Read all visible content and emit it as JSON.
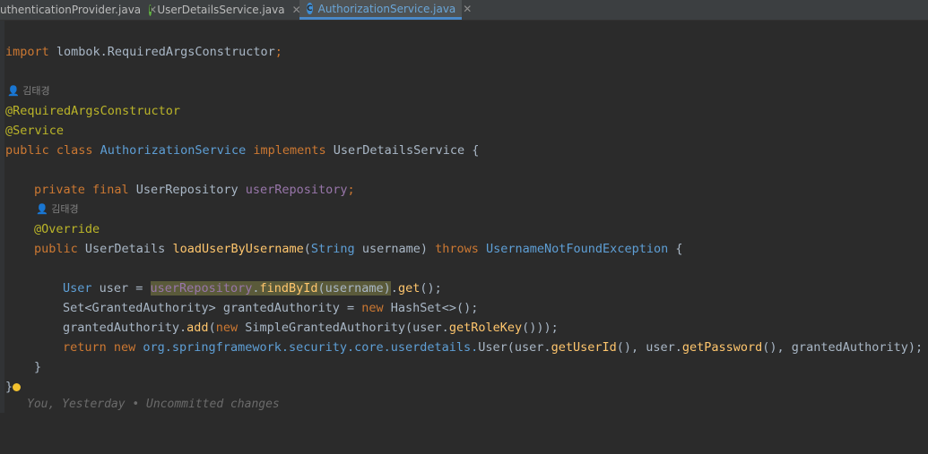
{
  "tabs": [
    {
      "label": "uthenticationProvider.java"
    },
    {
      "label": "UserDetailsService.java"
    },
    {
      "label": "AuthorizationService.java"
    }
  ],
  "author": "김태경",
  "code": {
    "l1": {
      "a": "import ",
      "b": "lombok.RequiredArgsConstructor",
      ";": ";"
    },
    "anno1": "@RequiredArgsConstructor",
    "anno2": "@Service",
    "cls": {
      "a": "public class ",
      "b": "AuthorizationService",
      "c": " implements ",
      "d": "UserDetailsService",
      "e": " {"
    },
    "field": {
      "a": "private final ",
      "b": "UserRepository ",
      "c": "userRepository",
      ";": ";"
    },
    "override": "@Override",
    "method": {
      "a": "public ",
      "b": "UserDetails ",
      "c": "loadUserByUsername",
      "d": "(",
      "e": "String ",
      "f": "username",
      ")": ")",
      "g": " throws ",
      "h": "UsernameNotFoundException",
      "i": " {"
    },
    "s1": {
      "a": "User ",
      "b": "user = ",
      "c": "userRepository",
      "d": ".",
      "e": "findById",
      "f": "(username)",
      "g": ".",
      "h": "get",
      "i": "();"
    },
    "s2": {
      "a": "Set",
      "b": "<",
      "c": "GrantedAuthority",
      "d": "> grantedAuthority = ",
      "e": "new ",
      "f": "HashSet",
      "g": "<>();"
    },
    "s3": {
      "a": "grantedAuthority.",
      "b": "add",
      "c": "(",
      "d": "new ",
      "e": "SimpleGrantedAuthority",
      "f": "(user.",
      "g": "getRoleKey",
      "h": "()));"
    },
    "s4": {
      "a": "return new ",
      "b": "org.springframework.security.core.userdetails.",
      "c": "User",
      "d": "(user.",
      "e": "getUserId",
      "f": "(), user.",
      "g": "getPassword",
      "h": "(), grantedAuthority);"
    },
    "close1": "}",
    "close2": "}"
  },
  "blame": "You, Yesterday • Uncommitted changes"
}
